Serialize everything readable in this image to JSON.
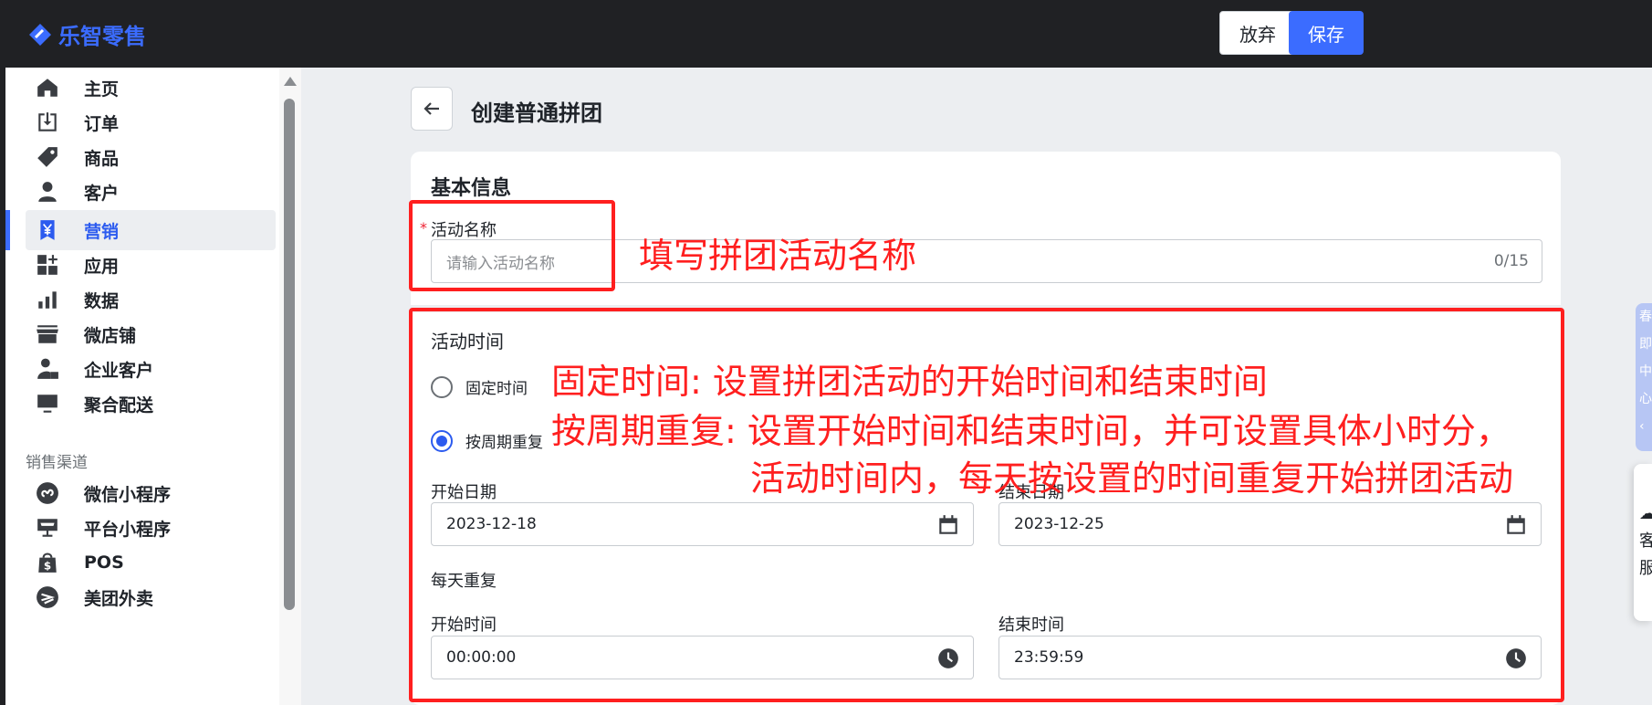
{
  "app": {
    "logo_text": "乐智零售"
  },
  "toolbar": {
    "discard_label": "放弃",
    "save_label": "保存"
  },
  "sidebar": {
    "items": [
      {
        "label": "主页",
        "icon": "home-icon"
      },
      {
        "label": "订单",
        "icon": "inbox-download-icon"
      },
      {
        "label": "商品",
        "icon": "tag-icon"
      },
      {
        "label": "客户",
        "icon": "person-icon"
      },
      {
        "label": "营销",
        "icon": "yen-badge-icon",
        "active": true
      },
      {
        "label": "应用",
        "icon": "apps-grid-icon"
      },
      {
        "label": "数据",
        "icon": "bar-chart-icon"
      },
      {
        "label": "微店铺",
        "icon": "store-icon"
      },
      {
        "label": "企业客户",
        "icon": "business-person-icon"
      },
      {
        "label": "聚合配送",
        "icon": "monitor-icon"
      }
    ],
    "sales_channel_title": "销售渠道",
    "channels": [
      {
        "label": "微信小程序",
        "icon": "mini-program-icon"
      },
      {
        "label": "平台小程序",
        "icon": "platform-store-icon"
      },
      {
        "label": "POS",
        "icon": "pos-bag-icon"
      },
      {
        "label": "美团外卖",
        "icon": "meituan-icon"
      }
    ]
  },
  "page": {
    "title": "创建普通拼团"
  },
  "basic_info": {
    "heading": "基本信息",
    "required_mark": "*",
    "name_label": "活动名称",
    "name_placeholder": "请输入活动名称",
    "name_count": "0/15"
  },
  "activity_time": {
    "label": "活动时间",
    "options": [
      {
        "label": "固定时间",
        "checked": false
      },
      {
        "label": "按周期重复",
        "checked": true
      }
    ],
    "start_date_label": "开始日期",
    "start_date": "2023-12-18",
    "end_date_label": "结束日期",
    "end_date": "2023-12-25",
    "daily_repeat_label": "每天重复",
    "start_time_label": "开始时间",
    "start_time": "00:00:00",
    "end_time_label": "结束时间",
    "end_time": "23:59:59"
  },
  "annotations": {
    "name_note": "填写拼团活动名称",
    "fixed_note": "固定时间: 设置拼团活动的开始时间和结束时间",
    "cycle_note_1": "按周期重复: 设置开始时间和结束时间，并可设置具体小时分，",
    "cycle_note_2": "活动时间内，每天按设置的时间重复开始拼团活动"
  },
  "float_widgets": {
    "tab_chars": [
      "春",
      "即",
      "中",
      "心",
      "‹"
    ],
    "card_chars": [
      "☁",
      "客",
      "服"
    ]
  },
  "colors": {
    "accent": "#3b6cff",
    "annotation": "#ff1f1f",
    "topbar": "#202124"
  }
}
